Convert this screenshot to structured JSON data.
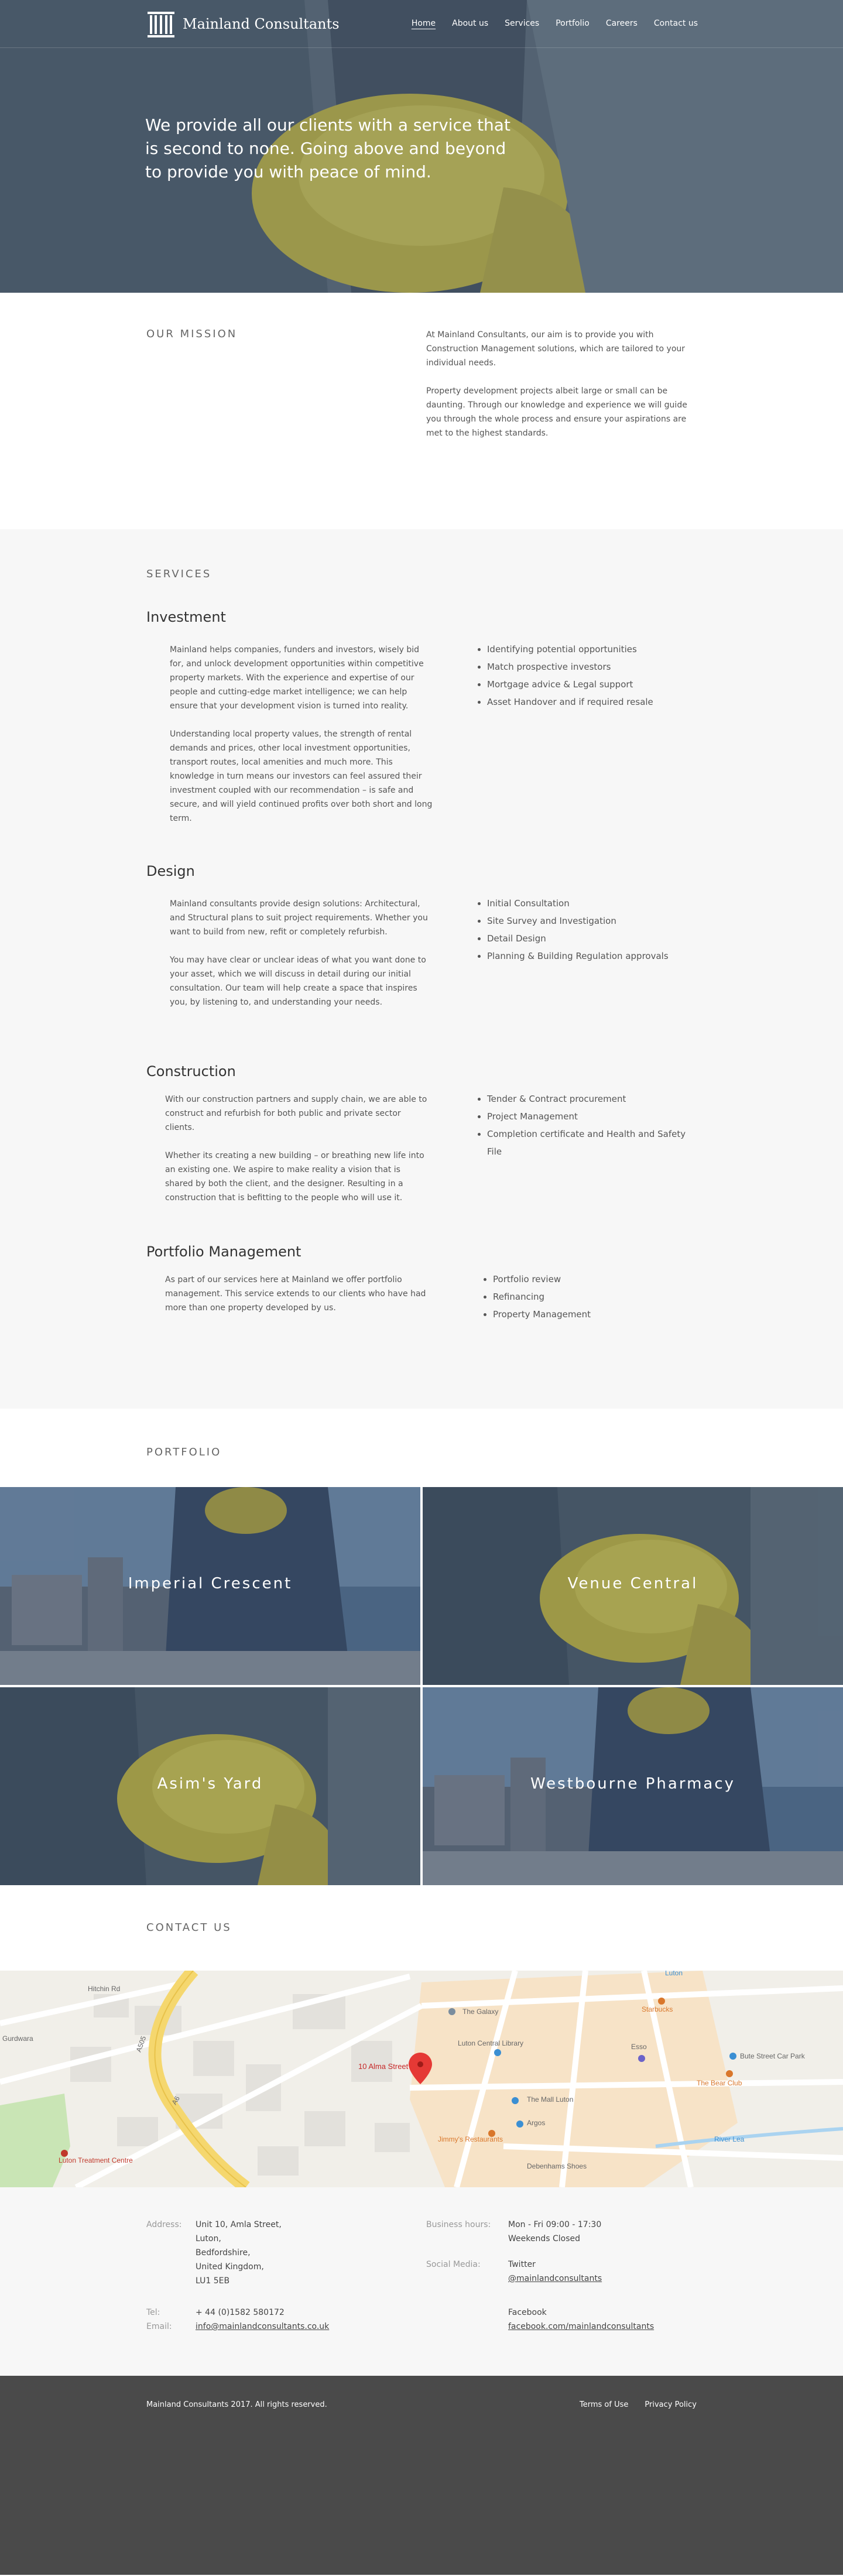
{
  "brand": {
    "name": "Mainland Consultants",
    "logo_icon": "building-columns-icon"
  },
  "nav": {
    "items": [
      {
        "label": "Home",
        "active": true
      },
      {
        "label": "About us"
      },
      {
        "label": "Services"
      },
      {
        "label": "Portfolio"
      },
      {
        "label": "Careers"
      },
      {
        "label": "Contact us"
      }
    ]
  },
  "hero": {
    "text": "We provide all our clients with a service that is second to none. Going above and beyond to provide you with peace of mind."
  },
  "mission": {
    "title": "OUR MISSION",
    "p1": "At Mainland Consultants, our aim is to provide you with Construction Management solutions, which are tailored to your individual needs.",
    "p2": "Property development projects albeit large or small can be daunting. Through our knowledge and experience we will guide you through the whole process and ensure your aspirations are met to the highest standards."
  },
  "services": {
    "title": "SERVICES",
    "investment": {
      "title": "Investment",
      "p1": "Mainland helps companies, funders and investors, wisely bid for, and unlock development opportunities within competitive property markets. With the experience and expertise of our people and cutting-edge market intelligence; we can help ensure that your development vision is turned into reality.",
      "p2": "Understanding local property values, the strength of rental demands and prices, other local investment opportunities, transport routes, local amenities and much more. This knowledge in turn means our investors can feel assured their investment coupled with our recommendation – is safe and secure, and will yield continued profits over both short and long term.",
      "items": [
        "Identifying potential opportunities",
        "Match prospective investors",
        "Mortgage advice & Legal support",
        "Asset Handover and if required resale"
      ]
    },
    "design": {
      "title": "Design",
      "p1": "Mainland consultants provide design solutions: Architectural, and Structural plans to suit project requirements. Whether you want to build from new, refit or completely refurbish.",
      "p2": "You may have clear or unclear ideas of what you want done to your asset, which we will discuss in detail during our initial consultation. Our team will help create a space that inspires you, by listening to, and understanding your needs.",
      "items": [
        "Initial Consultation",
        "Site Survey and Investigation",
        "Detail Design",
        "Planning & Building Regulation approvals"
      ]
    },
    "construction": {
      "title": "Construction",
      "p1": "With our construction partners and supply chain, we are able to construct and refurbish for both public and private sector clients.",
      "p2": "Whether its creating a new building – or breathing new life into an existing one. We aspire to make reality a vision that is shared by both the client, and the designer. Resulting in a construction that is befitting to the people who will use it.",
      "items": [
        "Tender & Contract procurement",
        "Project Management",
        "Completion certificate and Health and Safety File"
      ]
    },
    "portfolio_mgmt": {
      "title": "Portfolio Management",
      "p1": "As part of our services here at Mainland we offer portfolio management. This service extends to our clients who have had more than one property developed by us.",
      "items": [
        "Portfolio review",
        "Refinancing",
        "Property Management"
      ]
    }
  },
  "portfolio": {
    "title": "PORTFOLIO",
    "tiles": [
      {
        "title": "Imperial Crescent"
      },
      {
        "title": "Venue Central"
      },
      {
        "title": "Asim's Yard"
      },
      {
        "title": "Westbourne Pharmacy"
      }
    ]
  },
  "contact": {
    "title": "CONTACT US",
    "map": {
      "marker_label": "10 Alma Street",
      "places": [
        "The Galaxy",
        "Luton Central Library",
        "The Mall Luton",
        "Argos",
        "Jimmy's Restaurants",
        "Debenhams Shoes",
        "Starbucks",
        "Bute Street Car Park",
        "The Bear Club",
        "Luton Treatment Centre",
        "River Lea",
        "Luton",
        "Esso",
        "Hitchin Rd",
        "A505",
        "A6",
        "Gurdwara"
      ]
    },
    "address_label": "Address:",
    "address_lines": [
      "Unit 10, Amla Street,",
      "Luton,",
      "Bedfordshire,",
      "United Kingdom,",
      "LU1 5EB"
    ],
    "tel_label": "Tel:",
    "tel": "+ 44 (0)1582 580172",
    "email_label": "Email:",
    "email": "info@mainlandconsultants.co.uk",
    "hours_label": "Business hours:",
    "hours_lines": [
      "Mon - Fri 09:00 - 17:30",
      "Weekends Closed"
    ],
    "social_label": "Social Media:",
    "twitter_label": "Twitter",
    "twitter_handle": "@mainlandconsultants",
    "facebook_label": "Facebook",
    "facebook_url": "facebook.com/mainlandconsultants"
  },
  "footer": {
    "copyright": "Mainland Consultants 2017. All rights reserved.",
    "terms": "Terms of Use",
    "privacy": "Privacy Policy"
  }
}
